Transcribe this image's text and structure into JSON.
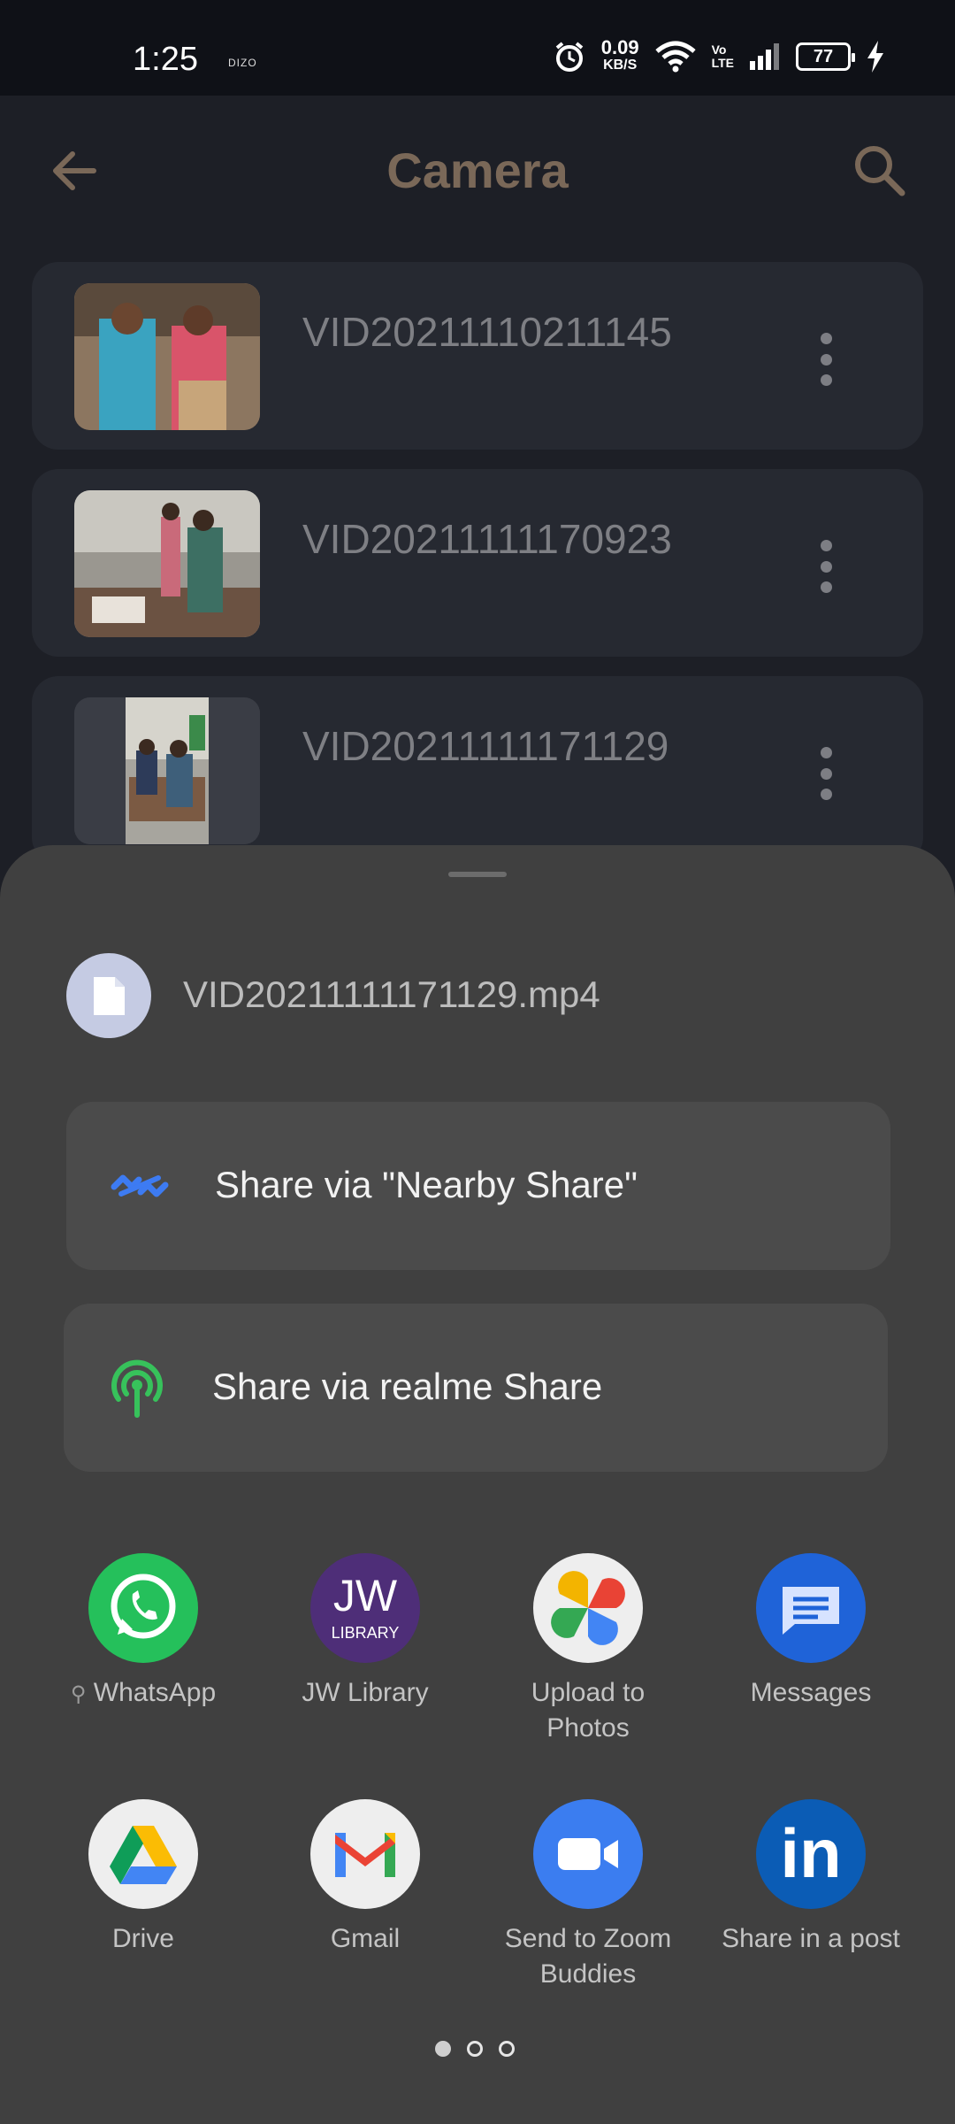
{
  "status_bar": {
    "time": "1:25",
    "brand": "DIZO",
    "speed_value": "0.09",
    "speed_unit": "KB/S",
    "volte_top": "Vo",
    "volte_bottom": "LTE",
    "battery": "77"
  },
  "header": {
    "title": "Camera",
    "icons": [
      "back-arrow-icon",
      "search-icon"
    ]
  },
  "videos": [
    {
      "name": "VID20211110211145"
    },
    {
      "name": "VID20211111170923"
    },
    {
      "name": "VID20211111171129"
    }
  ],
  "share_sheet": {
    "file_name": "VID20211111171129.mp4",
    "nearby_share_label": "Share via \"Nearby Share\"",
    "realme_share_label": "Share via realme Share",
    "apps": [
      {
        "label": "WhatsApp",
        "icon": "whatsapp-icon",
        "pinned": true
      },
      {
        "label": "JW Library",
        "icon": "jw-library-icon"
      },
      {
        "label": "Upload to Photos",
        "icon": "google-photos-icon"
      },
      {
        "label": "Messages",
        "icon": "messages-icon"
      },
      {
        "label": "Drive",
        "icon": "google-drive-icon"
      },
      {
        "label": "Gmail",
        "icon": "gmail-icon"
      },
      {
        "label": "Send to Zoom Buddies",
        "icon": "zoom-icon"
      },
      {
        "label": "Share in a post",
        "icon": "linkedin-icon"
      }
    ],
    "jw_text_top": "JW",
    "jw_text_bottom": "LIBRARY",
    "linkedin_text": "in",
    "pin_glyph": "⚲",
    "page_indicator": {
      "pages": 3,
      "current": 1
    }
  },
  "colors": {
    "sheet_bg": "#404040",
    "nearby_blue": "#3d7bf2",
    "realme_green": "#37c25b",
    "whatsapp_green": "#25c05b",
    "jw_purple": "#4e2e78",
    "messages_blue": "#1f63d8",
    "zoom_blue": "#3b7df0",
    "linkedin_blue": "#0b5cb5"
  }
}
